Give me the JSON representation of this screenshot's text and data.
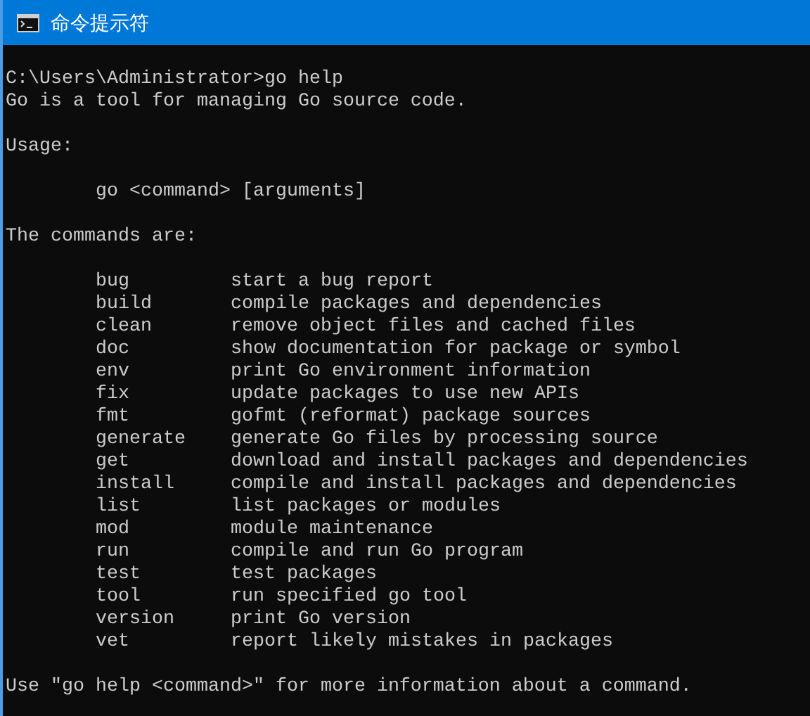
{
  "window": {
    "title": "命令提示符"
  },
  "lines_before": [
    {
      "kind": "text",
      "text": "C:\\Users\\Administrator>go help"
    },
    {
      "kind": "text",
      "text": "Go is a tool for managing Go source code."
    },
    {
      "kind": "blank"
    },
    {
      "kind": "text",
      "text": "Usage:"
    },
    {
      "kind": "blank"
    },
    {
      "kind": "indented",
      "text": "go <command> [arguments]"
    },
    {
      "kind": "blank"
    },
    {
      "kind": "text",
      "text": "The commands are:"
    },
    {
      "kind": "blank"
    }
  ],
  "commands": [
    {
      "name": "bug",
      "description": "start a bug report"
    },
    {
      "name": "build",
      "description": "compile packages and dependencies"
    },
    {
      "name": "clean",
      "description": "remove object files and cached files"
    },
    {
      "name": "doc",
      "description": "show documentation for package or symbol"
    },
    {
      "name": "env",
      "description": "print Go environment information"
    },
    {
      "name": "fix",
      "description": "update packages to use new APIs"
    },
    {
      "name": "fmt",
      "description": "gofmt (reformat) package sources"
    },
    {
      "name": "generate",
      "description": "generate Go files by processing source"
    },
    {
      "name": "get",
      "description": "download and install packages and dependencies"
    },
    {
      "name": "install",
      "description": "compile and install packages and dependencies"
    },
    {
      "name": "list",
      "description": "list packages or modules"
    },
    {
      "name": "mod",
      "description": "module maintenance"
    },
    {
      "name": "run",
      "description": "compile and run Go program"
    },
    {
      "name": "test",
      "description": "test packages"
    },
    {
      "name": "tool",
      "description": "run specified go tool"
    },
    {
      "name": "version",
      "description": "print Go version"
    },
    {
      "name": "vet",
      "description": "report likely mistakes in packages"
    }
  ],
  "lines_after": [
    {
      "kind": "blank"
    },
    {
      "kind": "text",
      "text": "Use \"go help <command>\" for more information about a command."
    }
  ]
}
